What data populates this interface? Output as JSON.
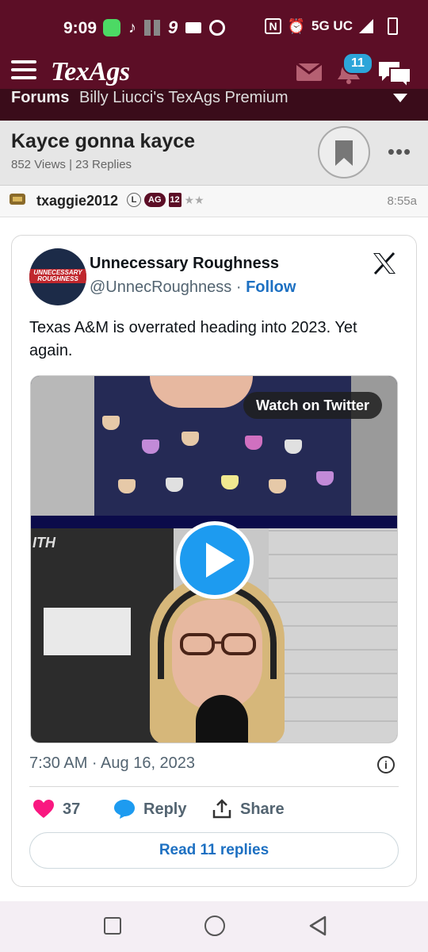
{
  "status_bar": {
    "time": "9:09",
    "notif_digit": "9",
    "network": "5G UC"
  },
  "app": {
    "logo": "TexAgs",
    "notification_count": "11"
  },
  "breadcrumb": {
    "section": "Forums",
    "forum": "Billy Liucci's TexAgs Premium"
  },
  "thread": {
    "title": "Kayce gonna kayce",
    "meta": "852 Views | 23 Replies"
  },
  "post": {
    "author": "txaggie2012",
    "badges": [
      "L",
      "AG",
      "12"
    ],
    "stars": "★★",
    "time": "8:55a"
  },
  "tweet": {
    "display_name": "Unnecessary Roughness",
    "handle": "@UnnecRoughness",
    "separator": "·",
    "follow_label": "Follow",
    "avatar_text": "UNNECESSARY ROUGHNESS",
    "text": "Texas A&M is overrated heading into 2023. Yet again.",
    "watch_label": "Watch on Twitter",
    "video_overlay_text": "ITH",
    "timestamp": "7:30 AM · Aug 16, 2023",
    "likes": "37",
    "reply_label": "Reply",
    "share_label": "Share",
    "read_replies_label": "Read 11 replies"
  },
  "colors": {
    "brand_maroon": "#5c0e26",
    "twitter_blue": "#1d9bf0",
    "link_blue": "#1d70c2",
    "like_pink": "#f91880"
  }
}
